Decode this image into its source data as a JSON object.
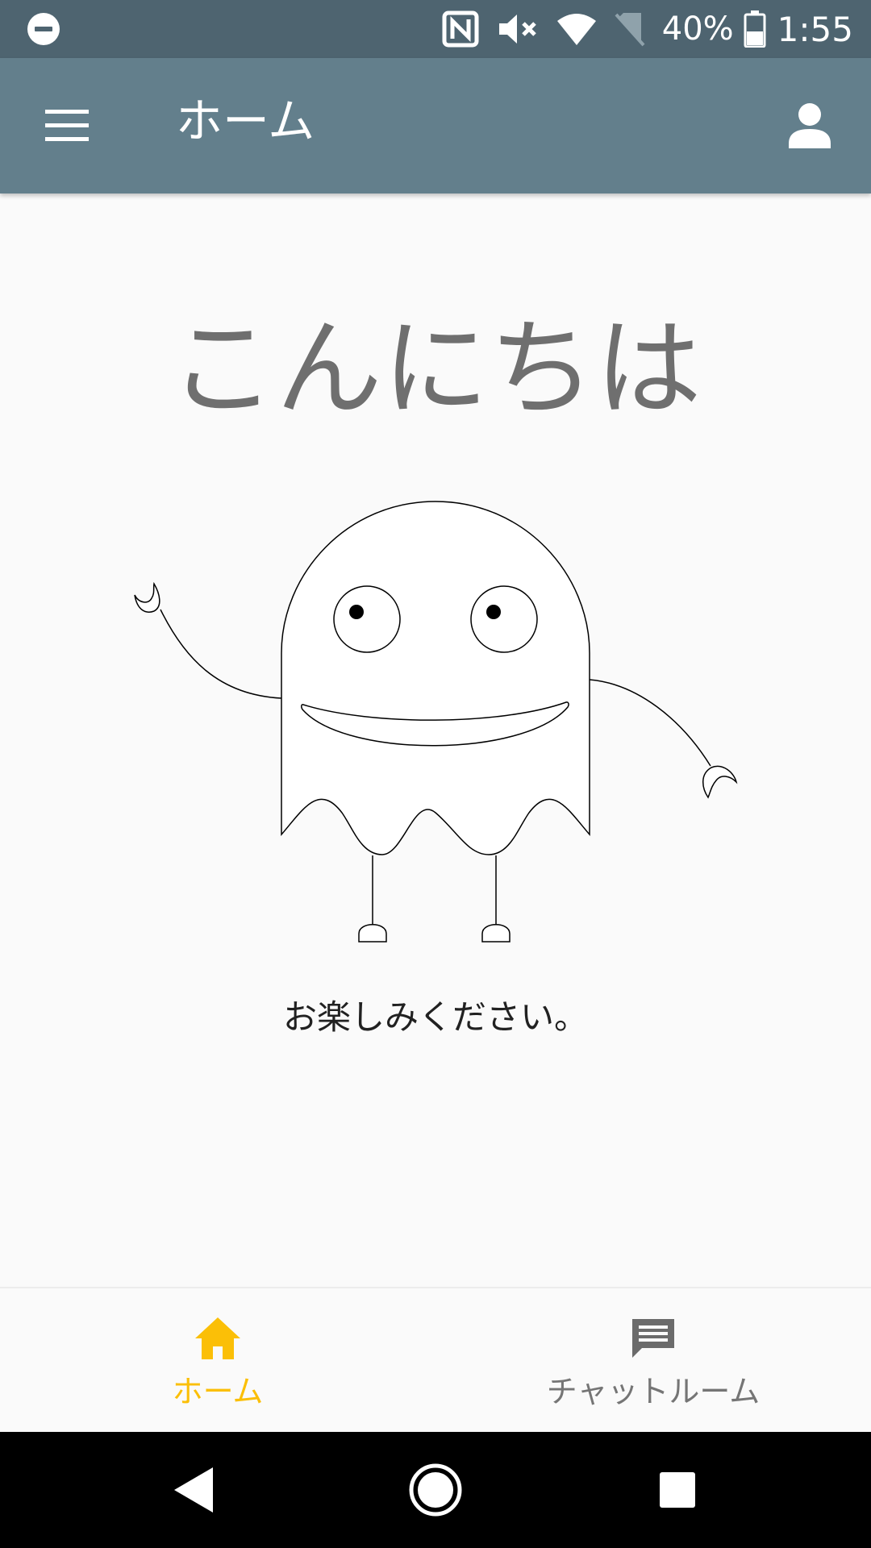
{
  "status_bar": {
    "battery_percent": "40%",
    "time": "1:55",
    "icons": [
      "do-not-disturb-icon",
      "nfc-icon",
      "volume-muted-icon",
      "wifi-icon",
      "no-sim-icon",
      "battery-icon"
    ]
  },
  "app_bar": {
    "title": "ホーム",
    "menu_icon": "menu-icon",
    "account_icon": "account-icon"
  },
  "main": {
    "greeting": "こんにちは",
    "illustration": "ghost-illustration",
    "message": "お楽しみください。"
  },
  "bottom_nav": {
    "items": [
      {
        "label": "ホーム",
        "icon": "home-icon",
        "active": true
      },
      {
        "label": "チャットルーム",
        "icon": "chat-icon",
        "active": false
      }
    ]
  },
  "system_nav": {
    "buttons": [
      "back-icon",
      "home-circle-icon",
      "recents-icon"
    ]
  },
  "colors": {
    "status_bar": "#4e6470",
    "app_bar": "#637f8c",
    "accent": "#fbbf07",
    "greeting_text": "#6f6f6f",
    "background": "#fafafa"
  }
}
